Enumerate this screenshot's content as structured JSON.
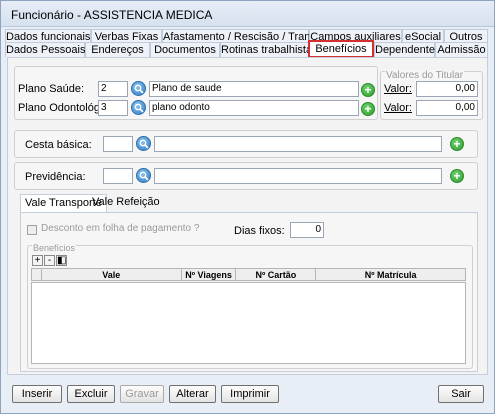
{
  "window": {
    "title": "Funcionário - ASSISTENCIA MEDICA"
  },
  "tabs_row1": [
    "Dados funcionais",
    "Verbas Fixas",
    "Afastamento / Rescisão / Transferência",
    "Campos auxiliares",
    "eSocial",
    "Outros"
  ],
  "tabs_row2": [
    "Dados Pessoais",
    "Endereços",
    "Documentos",
    "Rotinas trabalhistas",
    "Benefícios",
    "Dependentes",
    "Admissão"
  ],
  "health": {
    "plano_saude_label": "Plano Saúde:",
    "plano_saude_code": "2",
    "plano_saude_name": "Plano de saude",
    "plano_odonto_label": "Plano Odontológico:",
    "plano_odonto_code": "3",
    "plano_odonto_name": "plano odonto",
    "titular_group": "Valores do Titular",
    "valor_label": "Valor:",
    "valor_saude": "0,00",
    "valor_odonto": "0,00"
  },
  "cesta": {
    "label": "Cesta básica:",
    "code": "",
    "name": ""
  },
  "previdencia": {
    "label": "Previdência:",
    "code": "",
    "name": ""
  },
  "subtabs": [
    "Vale Transporte",
    "Vale Refeição"
  ],
  "vale_transporte": {
    "desconto_label": "Desconto em folha de pagamento ?",
    "dias_label": "Dias fixos:",
    "dias_value": "0",
    "beneficios_label": "Benefícios",
    "grid_buttons": [
      "+",
      "-",
      "◧"
    ],
    "columns": [
      "Vale",
      "Nº Viagens",
      "Nº Cartão",
      "Nº Matrícula"
    ]
  },
  "buttons": {
    "inserir": "Inserir",
    "excluir": "Excluir",
    "gravar": "Gravar",
    "alterar": "Alterar",
    "imprimir": "Imprimir",
    "sair": "Sair"
  },
  "colors": {
    "accent": "#2f7bc4",
    "add": "#2f9b2f",
    "active_tab_outline": "#d62f2f"
  },
  "icons": {
    "search": "search-icon",
    "add": "plus-circle-icon"
  }
}
